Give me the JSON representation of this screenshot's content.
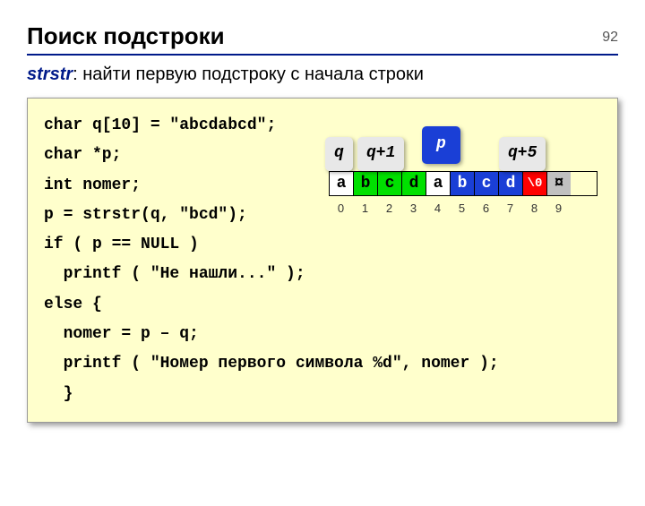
{
  "page_number": "92",
  "title": "Поиск подстроки",
  "subtitle_fn": "strstr",
  "subtitle_rest": ": найти первую подстроку с начала строки",
  "code": {
    "l1": "char q[10] = \"abcdabcd\";",
    "l2": "char *p;",
    "l3": "int nomer;",
    "l4": "p = strstr(q, \"bcd\");",
    "l5": "if ( p == NULL )",
    "l6": "  printf ( \"Не нашли...\" );",
    "l7": "else {",
    "l8": "  nomer = p – q;",
    "l9": "  printf ( \"Номер первого символа %d\", nomer );",
    "l10": "  }"
  },
  "pointers": {
    "q": "q",
    "q1": "q+1",
    "p": "p",
    "q5": "q+5"
  },
  "cells": [
    "a",
    "b",
    "c",
    "d",
    "a",
    "b",
    "c",
    "d",
    "\\0",
    "¤"
  ],
  "indices": [
    "0",
    "1",
    "2",
    "3",
    "4",
    "5",
    "6",
    "7",
    "8",
    "9"
  ]
}
